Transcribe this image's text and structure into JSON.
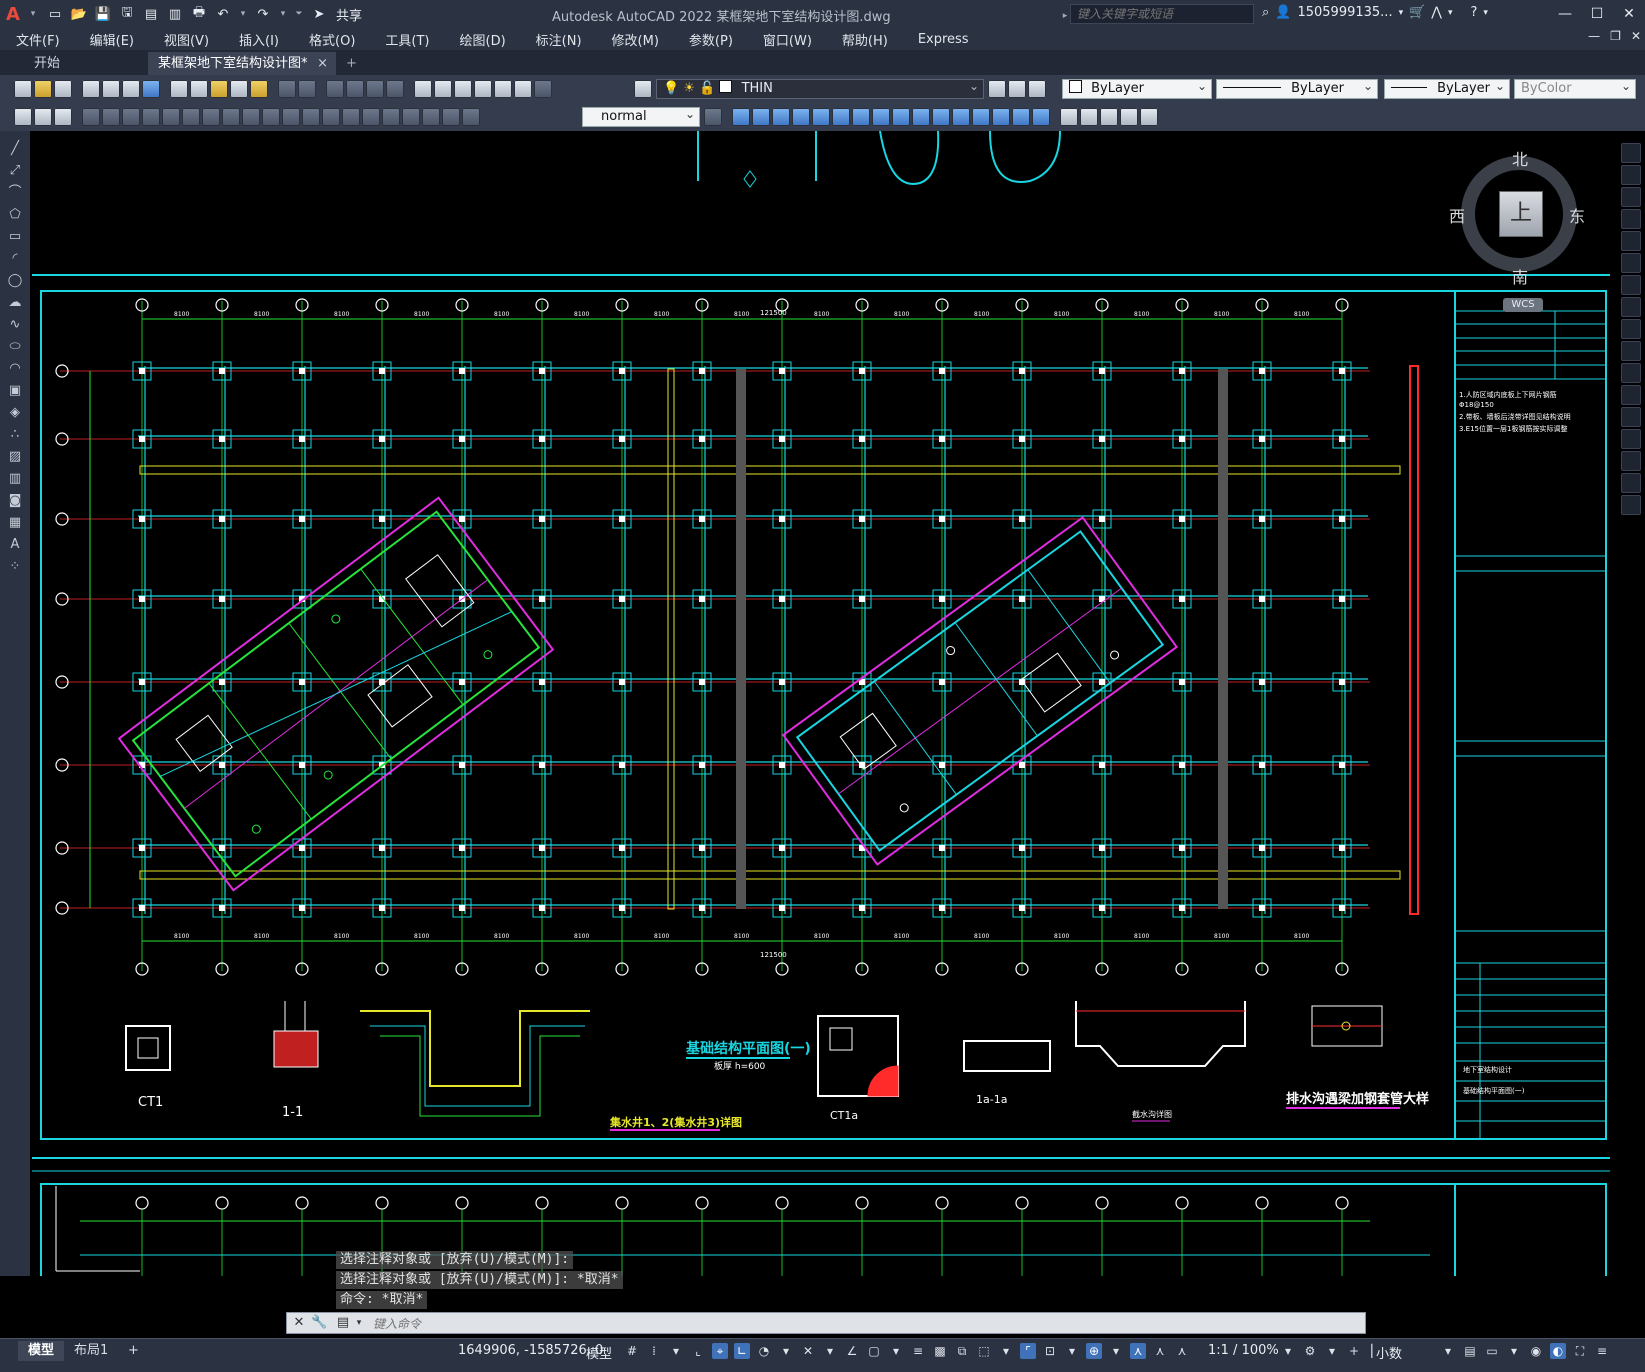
{
  "app": {
    "title": "Autodesk AutoCAD 2022    某框架地下室结构设计图.dwg",
    "share_label": "共享",
    "search_placeholder": "键入关键字或短语",
    "user": "1505999135...",
    "logo": "A"
  },
  "menu": [
    "文件(F)",
    "编辑(E)",
    "视图(V)",
    "插入(I)",
    "格式(O)",
    "工具(T)",
    "绘图(D)",
    "标注(N)",
    "修改(M)",
    "参数(P)",
    "窗口(W)",
    "帮助(H)",
    "Express"
  ],
  "tabs": {
    "start": "开始",
    "file": "某框架地下室结构设计图*",
    "close": "×",
    "add": "+"
  },
  "toolbar": {
    "layer": "THIN",
    "color": "ByLayer",
    "linetype": "ByLayer",
    "lineweight": "ByLayer",
    "plotstyle": "ByColor",
    "textstyle": "normal"
  },
  "viewcube": {
    "north": "北",
    "south": "南",
    "east": "东",
    "west": "西",
    "face": "上",
    "wcs": "WCS"
  },
  "drawing": {
    "plan_title": "基础结构平面图(一)",
    "plan_subtitle": "板厚 h=600",
    "pit_title": "集水井1、2(集水井3)详图",
    "trench_title": "排水沟遇梁加钢套管大样",
    "sump_title": "截水沟详图",
    "ct1": "CT1",
    "ct1a": "CT1a",
    "sec11": "1-1",
    "sec1a": "1a-1a",
    "total_dim": "121500",
    "bay_dim": "8100",
    "title_block": {
      "drawing_name": "地下室结构设计",
      "sheet_name": "基础结构平面图(一)"
    },
    "notes": [
      "1.人防区域内底板上下网片钢筋",
      "  Φ18@150",
      "2.带板、墙板后浇带详图见结构说明",
      "3.E15位置一层1板钢筋按实际调整"
    ]
  },
  "command": {
    "history": [
      "选择注释对象或 [放弃(U)/模式(M)]:",
      "选择注释对象或 [放弃(U)/模式(M)]: *取消*",
      "命令: *取消*"
    ],
    "placeholder": "键入命令"
  },
  "status": {
    "model_tab": "模型",
    "layout_tab": "布局1",
    "add_tab": "+",
    "coords": "1649906, -1585726, 0",
    "model": "模型",
    "scale": "1:1 / 100%",
    "units": "小数"
  },
  "colors": {
    "cyan": "#19d6e0",
    "green": "#27e33a",
    "magenta": "#e02de0",
    "red": "#ff2b2b",
    "yellow": "#e6e62a",
    "white": "#ffffff"
  }
}
